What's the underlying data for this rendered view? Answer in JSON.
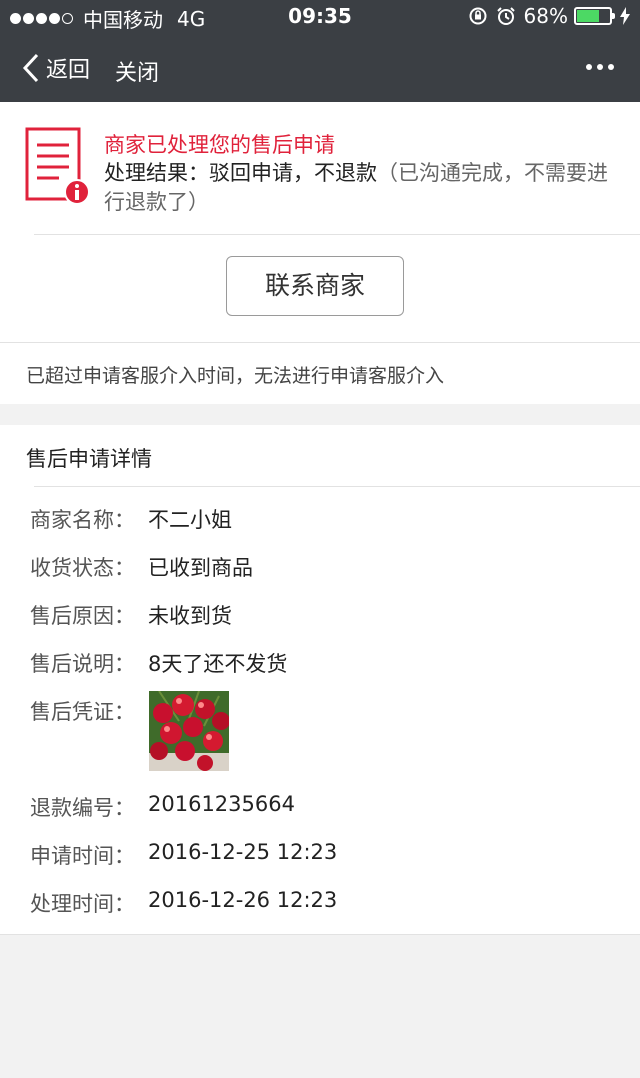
{
  "status_bar": {
    "carrier": "中国移动",
    "network": "4G",
    "time": "09:35",
    "battery": "68%",
    "battery_level": 0.68
  },
  "nav": {
    "back_label": "返回",
    "close_label": "关闭"
  },
  "result": {
    "title": "商家已处理您的售后申请",
    "body_main": "处理结果：驳回申请，不退款",
    "body_note": "（已沟通完成，不需要进行退款了）",
    "contact_button": "联系商家",
    "notice": "已超过申请客服介入时间，无法进行申请客服介入"
  },
  "details": {
    "heading": "售后申请详情",
    "rows": [
      {
        "label": "商家名称：",
        "value": "不二小姐"
      },
      {
        "label": "收货状态：",
        "value": "已收到商品"
      },
      {
        "label": "售后原因：",
        "value": "未收到货"
      },
      {
        "label": "售后说明：",
        "value": "8天了还不发货"
      },
      {
        "label": "售后凭证：",
        "value": ""
      },
      {
        "label": "退款编号：",
        "value": "20161235664"
      },
      {
        "label": "申请时间：",
        "value": "2016-12-25 12:23"
      },
      {
        "label": "处理时间：",
        "value": "2016-12-26 12:23"
      }
    ]
  },
  "colors": {
    "accent_red": "#e0223b",
    "nav_bg": "#3b3f44",
    "battery_green": "#4cd964"
  },
  "icons": [
    "chevron-left-icon",
    "more-icon",
    "document-info-icon",
    "rotation-lock-icon",
    "alarm-icon",
    "battery-icon",
    "charging-icon",
    "cherry-photo"
  ]
}
